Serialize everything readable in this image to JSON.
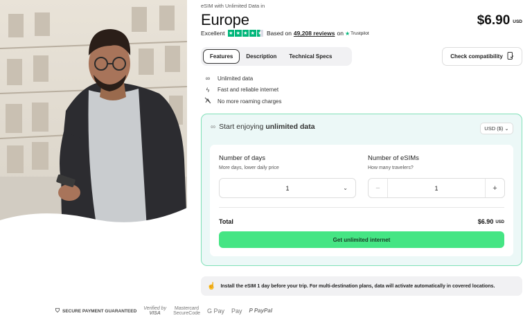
{
  "product": {
    "eyebrow": "eSIM with Unlimited Data in",
    "title": "Europe",
    "price": "$6.90",
    "currency_code": "USD"
  },
  "rating": {
    "label": "Excellent",
    "stars_value": 4.5,
    "stars_max": 5,
    "based_on_prefix": "Based on",
    "reviews_link": "49,208 reviews",
    "on_text": "on",
    "provider": "Trustpilot",
    "star_color": "#00b67a"
  },
  "tabs": [
    {
      "label": "Features",
      "active": true
    },
    {
      "label": "Description",
      "active": false
    },
    {
      "label": "Technical Specs",
      "active": false
    }
  ],
  "check_compatibility": {
    "label": "Check compatibility",
    "icon": "phone-check-icon"
  },
  "features": [
    {
      "icon": "infinity-icon",
      "label": "Unlimited data"
    },
    {
      "icon": "lightning-icon",
      "label": "Fast and reliable internet"
    },
    {
      "icon": "no-roaming-icon",
      "label": "No more roaming charges"
    }
  ],
  "card": {
    "heading_prefix": "Start enjoying",
    "heading_bold": "unlimited data",
    "currency_select": "USD ($)",
    "days": {
      "label": "Number of days",
      "sub": "More days, lower daily price",
      "value": "1"
    },
    "esims": {
      "label": "Number of eSIMs",
      "sub": "How many travelers?",
      "value": "1",
      "minus": "−",
      "plus": "+"
    },
    "total_label": "Total",
    "total_value": "$6.90",
    "total_currency": "USD",
    "cta": "Get unlimited internet",
    "cta_color": "#45e584"
  },
  "notice": {
    "text": "Install the eSIM 1 day before your trip. For multi-destination plans, data will activate automatically in covered locations."
  },
  "payments": {
    "secure": "SECURE PAYMENT GUARANTEED",
    "visa_line1": "Verified by",
    "visa_line2": "VISA",
    "mc_line1": "Mastercard",
    "mc_line2": "SecureCode",
    "gpay": "G Pay",
    "apay": "Pay",
    "paypal": "PayPal"
  }
}
